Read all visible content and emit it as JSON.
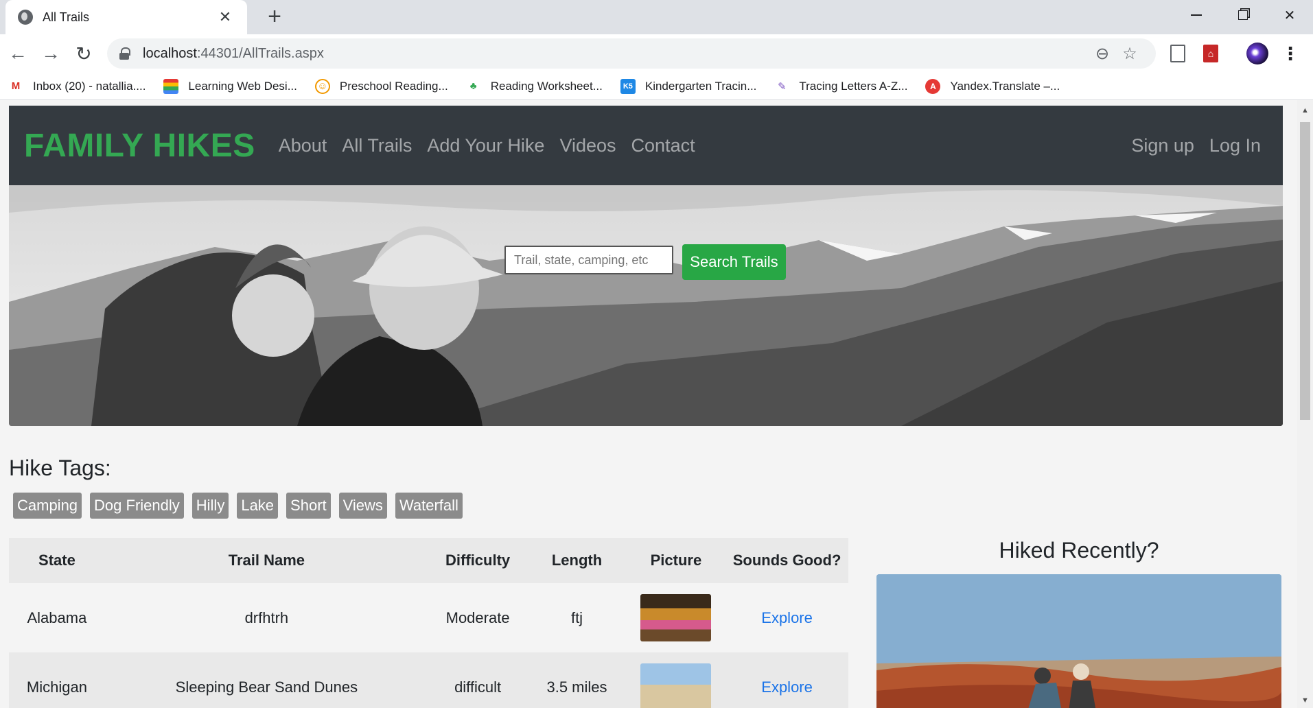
{
  "browser": {
    "tab_title": "All Trails",
    "url_host": "localhost",
    "url_path": ":44301/AllTrails.aspx",
    "bookmarks": [
      {
        "label": "Inbox (20) - natallia....",
        "icon": "gmail-icon",
        "color": "#d93025"
      },
      {
        "label": "Learning Web Desi...",
        "icon": "book-icon",
        "color": "#4285f4"
      },
      {
        "label": "Preschool Reading...",
        "icon": "lion-icon",
        "color": "#f29900"
      },
      {
        "label": "Reading Worksheet...",
        "icon": "worksheet-icon",
        "color": "#34a853"
      },
      {
        "label": "Kindergarten Tracin...",
        "icon": "k5-icon",
        "color": "#1e88e5"
      },
      {
        "label": "Tracing Letters A-Z...",
        "icon": "pencil-icon",
        "color": "#7e57c2"
      },
      {
        "label": "Yandex.Translate –...",
        "icon": "translate-icon",
        "color": "#e53935"
      }
    ]
  },
  "site": {
    "brand": "FAMILY HIKES",
    "nav": [
      "About",
      "All Trails",
      "Add Your Hike",
      "Videos",
      "Contact"
    ],
    "auth": [
      "Sign up",
      "Log In"
    ],
    "accent": "#34a853"
  },
  "hero": {
    "search_placeholder": "Trail, state, camping, etc",
    "search_button": "Search Trails"
  },
  "tags": {
    "title": "Hike Tags:",
    "items": [
      "Camping",
      "Dog Friendly",
      "Hilly",
      "Lake",
      "Short",
      "Views",
      "Waterfall"
    ]
  },
  "table": {
    "headers": [
      "State",
      "Trail Name",
      "Difficulty",
      "Length",
      "Picture",
      "Sounds Good?"
    ],
    "rows": [
      {
        "state": "Alabama",
        "name": "drfhtrh",
        "difficulty": "Moderate",
        "length": "ftj",
        "link": "Explore"
      },
      {
        "state": "Michigan",
        "name": "Sleeping Bear Sand Dunes",
        "difficulty": "difficult",
        "length": "3.5 miles",
        "link": "Explore"
      }
    ]
  },
  "sidebar": {
    "title": "Hiked Recently?"
  }
}
